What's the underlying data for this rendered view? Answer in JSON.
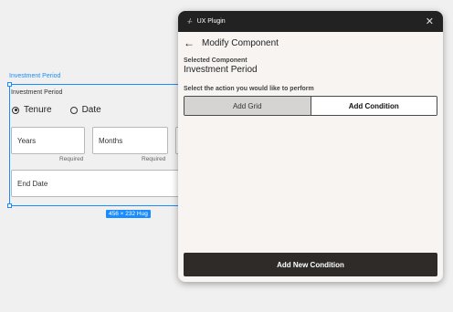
{
  "canvas": {
    "frame_label": "Investment Period",
    "component": {
      "title": "Investment Period",
      "radio_options": [
        {
          "label": "Tenure",
          "selected": true
        },
        {
          "label": "Date",
          "selected": false
        }
      ],
      "fields": {
        "years": {
          "label": "Years",
          "hint": "Required"
        },
        "months": {
          "label": "Months",
          "hint": "Required"
        },
        "end_date": {
          "label": "End Date"
        }
      }
    },
    "size_badge": "456 × 232 Hug"
  },
  "plugin": {
    "title": "UX Plugin",
    "logo_icon": "plugin-logo-icon",
    "close_icon": "close-icon",
    "header": {
      "back_icon": "arrow-left-icon",
      "title": "Modify Component"
    },
    "selected_component": {
      "label": "Selected Component",
      "value": "Investment Period"
    },
    "action_prompt": "Select the action you would like to perform",
    "actions": [
      {
        "label": "Add Grid",
        "active": true
      },
      {
        "label": "Add Condition",
        "active": false
      }
    ],
    "primary_button": "Add New Condition"
  },
  "colors": {
    "selection": "#1a8cff",
    "titlebar": "#222222",
    "panel": "#f7f4f1",
    "primary_button": "#2e2b29"
  }
}
